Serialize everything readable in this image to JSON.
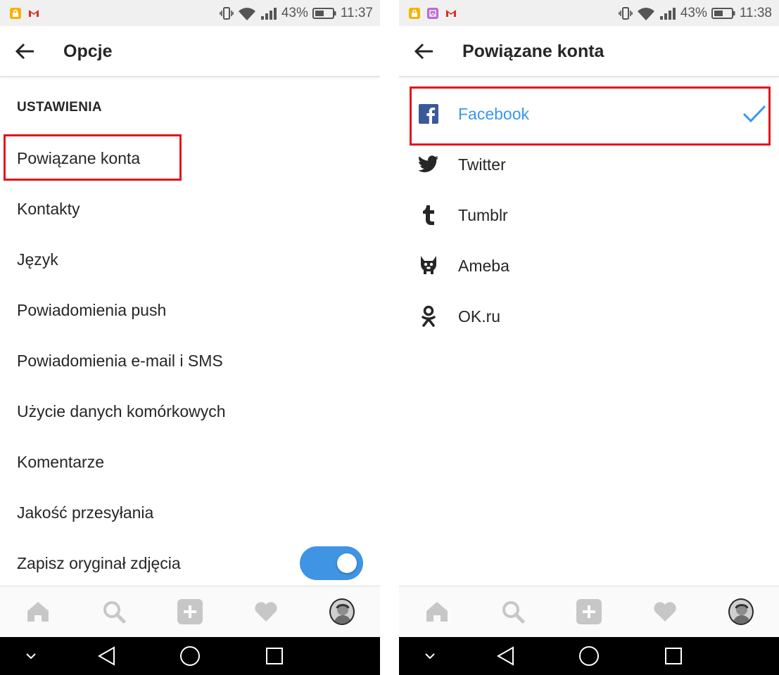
{
  "left": {
    "status": {
      "battery": "43%",
      "time": "11:37"
    },
    "app_bar": {
      "title": "Opcje"
    },
    "section_header": "USTAWIENIA",
    "items": [
      {
        "label": "Powiązane konta"
      },
      {
        "label": "Kontakty"
      },
      {
        "label": "Język"
      },
      {
        "label": "Powiadomienia push"
      },
      {
        "label": "Powiadomienia e-mail i SMS"
      },
      {
        "label": "Użycie danych komórkowych"
      },
      {
        "label": "Komentarze"
      },
      {
        "label": "Jakość przesyłania"
      },
      {
        "label": "Zapisz oryginał zdjęcia"
      }
    ],
    "save_original_toggle": "on"
  },
  "right": {
    "status": {
      "battery": "43%",
      "time": "11:38"
    },
    "app_bar": {
      "title": "Powiązane konta"
    },
    "accounts": [
      {
        "label": "Facebook",
        "icon": "facebook-icon",
        "linked": true
      },
      {
        "label": "Twitter",
        "icon": "twitter-icon",
        "linked": false
      },
      {
        "label": "Tumblr",
        "icon": "tumblr-icon",
        "linked": false
      },
      {
        "label": "Ameba",
        "icon": "ameba-icon",
        "linked": false
      },
      {
        "label": "OK.ru",
        "icon": "okru-icon",
        "linked": false
      }
    ]
  },
  "tabs": [
    "home-icon",
    "search-icon",
    "add-icon",
    "heart-icon",
    "profile-avatar"
  ],
  "colors": {
    "accent": "#3897f0",
    "toggle": "#3f94e4",
    "highlight": "#e3131b",
    "text": "#262626",
    "icon_gray": "#c7c7c7"
  }
}
